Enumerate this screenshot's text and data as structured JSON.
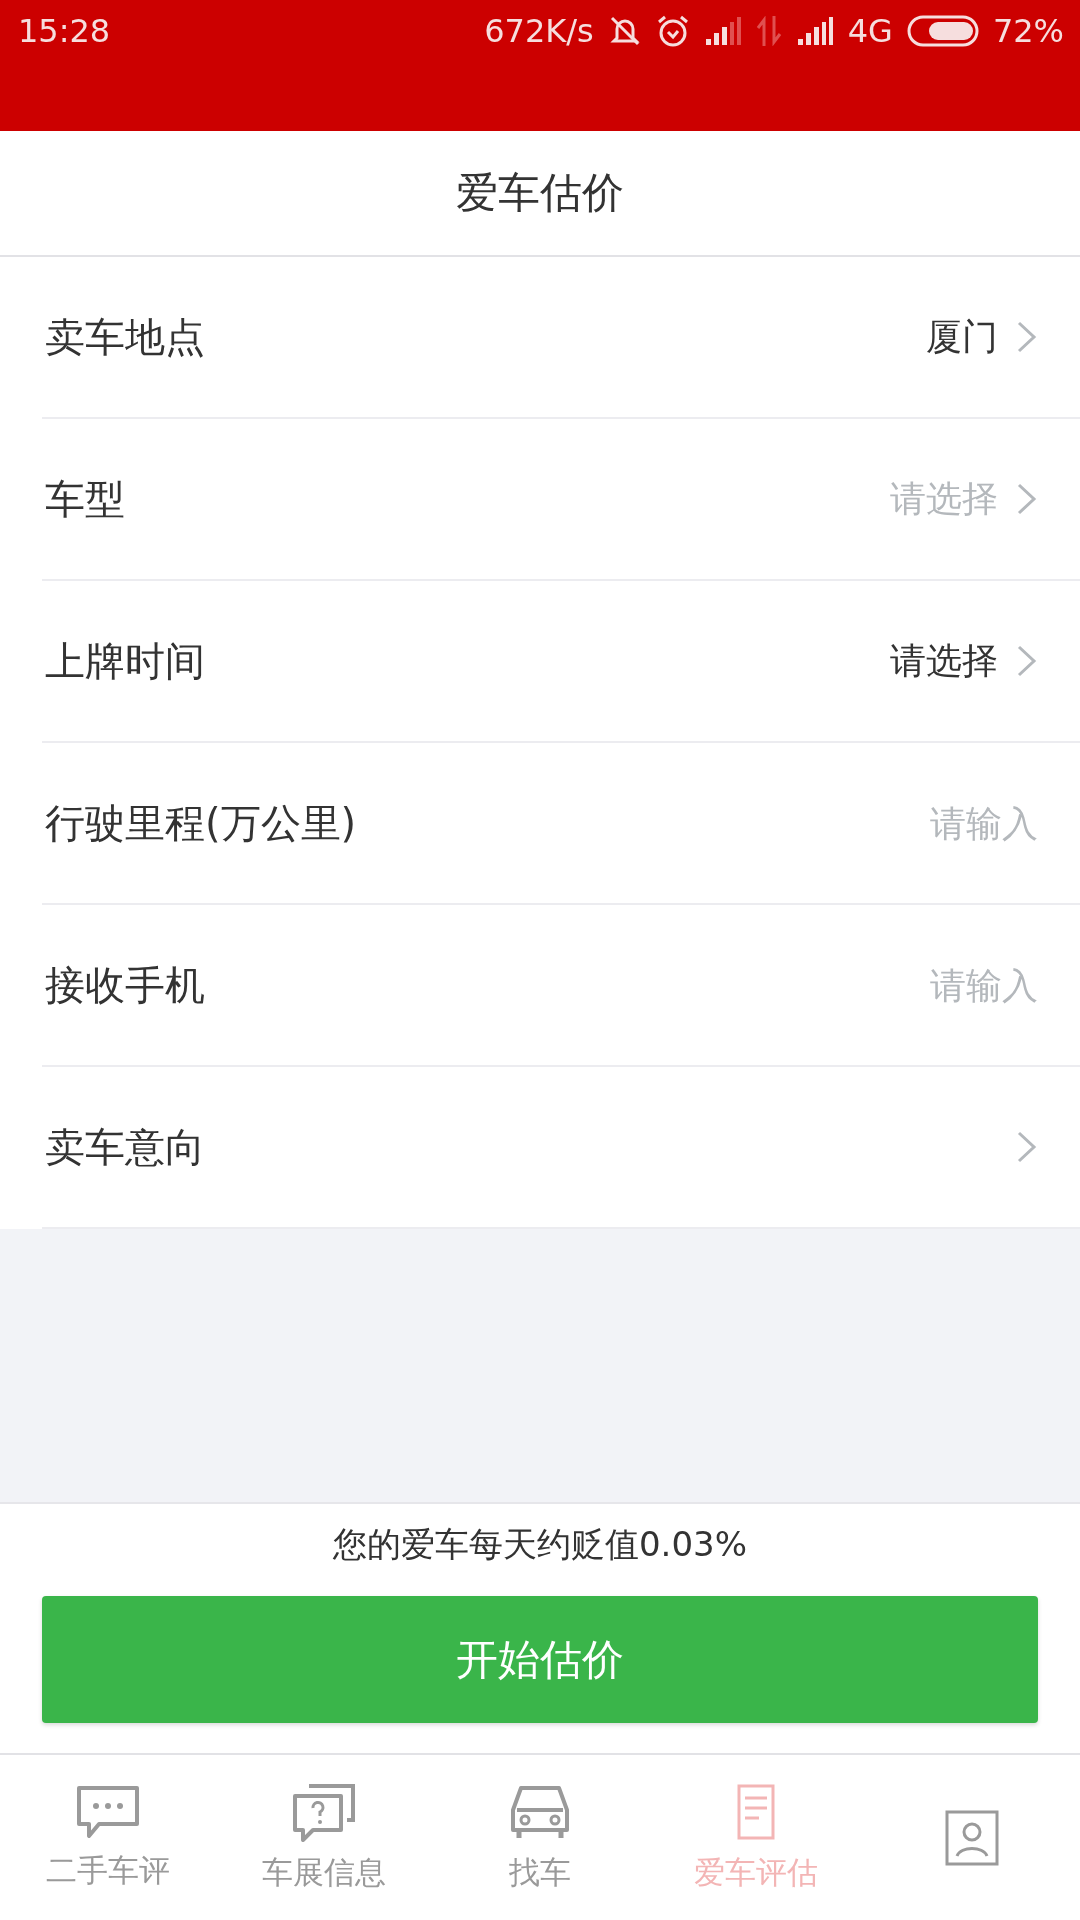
{
  "status_bar": {
    "time": "15:28",
    "speed": "672K/s",
    "network": "4G",
    "battery": "72%"
  },
  "header": {
    "title": "爱车估价"
  },
  "rows": [
    {
      "kind": "select",
      "label": "卖车地点",
      "value": "厦门"
    },
    {
      "kind": "select",
      "label": "车型",
      "placeholder": "请选择"
    },
    {
      "kind": "select",
      "label": "上牌时间",
      "value": "请选择"
    },
    {
      "kind": "input",
      "label": "行驶里程(万公里)",
      "placeholder": "请输入"
    },
    {
      "kind": "input",
      "label": "接收手机",
      "placeholder": "请输入"
    },
    {
      "kind": "select",
      "label": "卖车意向"
    }
  ],
  "footer": {
    "note": "您的爱车每天约贬值0.03%",
    "button": "开始估价"
  },
  "tabs": [
    {
      "kind": "chat",
      "label": "二手车评",
      "selected": false
    },
    {
      "kind": "question",
      "label": "车展信息",
      "selected": false
    },
    {
      "kind": "car",
      "label": "找车",
      "selected": false
    },
    {
      "kind": "doc",
      "label": "爱车评估",
      "selected": true
    },
    {
      "kind": "user",
      "selected": false
    }
  ]
}
